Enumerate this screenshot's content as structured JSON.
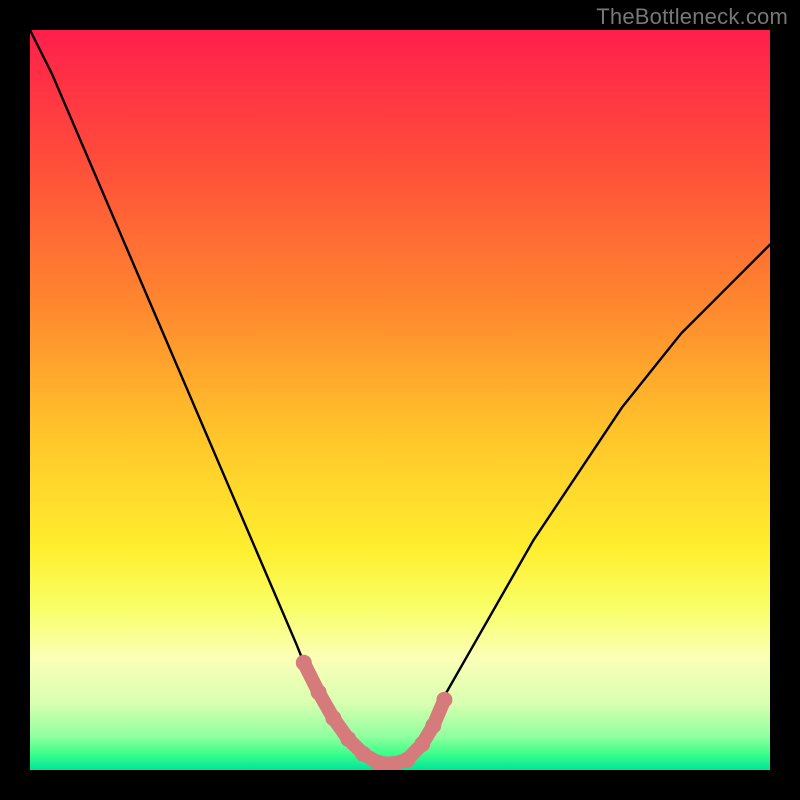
{
  "watermark": "TheBottleneck.com",
  "colors": {
    "frame": "#000000",
    "curve": "#000000",
    "marker": "#d67b7b",
    "gradient_stops": [
      {
        "offset": 0.0,
        "color": "#ff1f4b"
      },
      {
        "offset": 0.18,
        "color": "#ff4e3a"
      },
      {
        "offset": 0.38,
        "color": "#ff8a2e"
      },
      {
        "offset": 0.55,
        "color": "#ffc62a"
      },
      {
        "offset": 0.7,
        "color": "#ffee2e"
      },
      {
        "offset": 0.78,
        "color": "#f9ff66"
      },
      {
        "offset": 0.85,
        "color": "#fbffb8"
      },
      {
        "offset": 0.91,
        "color": "#d8ffb0"
      },
      {
        "offset": 0.955,
        "color": "#8fff9f"
      },
      {
        "offset": 0.978,
        "color": "#3dff8a"
      },
      {
        "offset": 1.0,
        "color": "#00e49a"
      }
    ]
  },
  "chart_data": {
    "type": "line",
    "title": "",
    "xlabel": "",
    "ylabel": "",
    "xlim": [
      0,
      1
    ],
    "ylim": [
      0,
      1
    ],
    "note": "Values estimated from pixel positions; x,y in normalized [0,1] plot coordinates where y=0 is bottom (green band). Second series marks the highlighted segment near the minimum.",
    "series": [
      {
        "name": "bottleneck-curve",
        "x": [
          0.0,
          0.03,
          0.06,
          0.09,
          0.12,
          0.15,
          0.18,
          0.21,
          0.24,
          0.27,
          0.3,
          0.33,
          0.36,
          0.38,
          0.4,
          0.42,
          0.44,
          0.46,
          0.48,
          0.5,
          0.52,
          0.54,
          0.56,
          0.6,
          0.64,
          0.68,
          0.72,
          0.76,
          0.8,
          0.84,
          0.88,
          0.92,
          0.96,
          1.0
        ],
        "y": [
          1.0,
          0.94,
          0.87,
          0.8,
          0.73,
          0.66,
          0.59,
          0.52,
          0.45,
          0.38,
          0.31,
          0.24,
          0.17,
          0.12,
          0.08,
          0.05,
          0.025,
          0.012,
          0.008,
          0.012,
          0.03,
          0.06,
          0.1,
          0.17,
          0.24,
          0.31,
          0.37,
          0.43,
          0.49,
          0.54,
          0.59,
          0.63,
          0.67,
          0.71
        ]
      },
      {
        "name": "highlighted-near-minimum",
        "x": [
          0.37,
          0.39,
          0.41,
          0.43,
          0.45,
          0.47,
          0.49,
          0.51,
          0.53,
          0.545,
          0.56
        ],
        "y": [
          0.145,
          0.105,
          0.07,
          0.042,
          0.022,
          0.01,
          0.008,
          0.014,
          0.035,
          0.06,
          0.095
        ]
      }
    ]
  }
}
